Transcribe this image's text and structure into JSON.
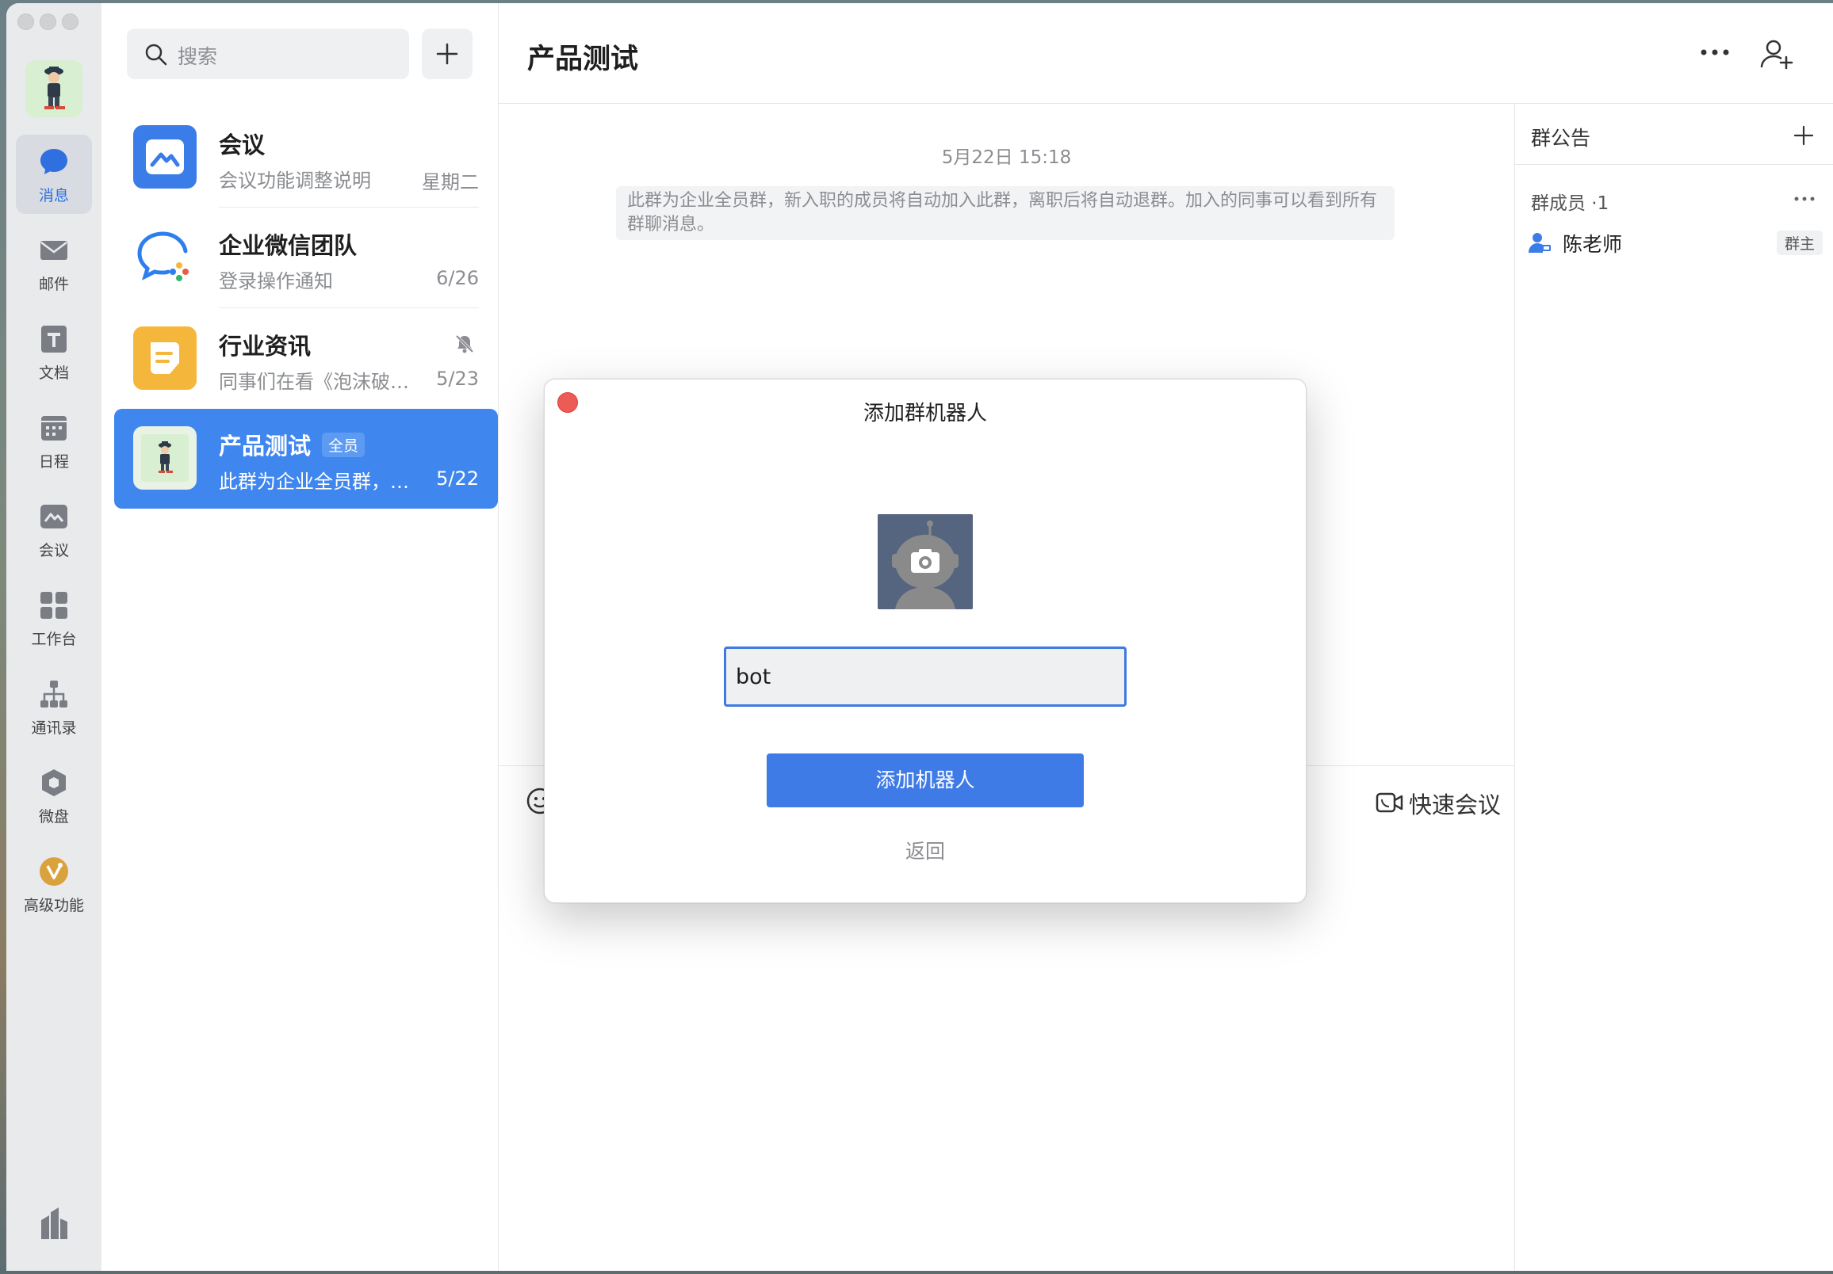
{
  "rail": {
    "items": [
      {
        "id": "messages",
        "label": "消息",
        "active": true
      },
      {
        "id": "mail",
        "label": "邮件"
      },
      {
        "id": "docs",
        "label": "文档"
      },
      {
        "id": "calendar",
        "label": "日程"
      },
      {
        "id": "meeting",
        "label": "会议"
      },
      {
        "id": "workbench",
        "label": "工作台"
      },
      {
        "id": "contacts",
        "label": "通讯录"
      },
      {
        "id": "drive",
        "label": "微盘"
      },
      {
        "id": "advanced",
        "label": "高级功能"
      }
    ]
  },
  "search": {
    "placeholder": "搜索"
  },
  "conversations": [
    {
      "name": "会议",
      "preview": "会议功能调整说明",
      "time": "星期二",
      "icon": "meeting-app-icon",
      "color": "#3b7de8"
    },
    {
      "name": "企业微信团队",
      "preview": "登录操作通知",
      "time": "6/26",
      "icon": "wecom-team-icon",
      "color": "#2d7ff0"
    },
    {
      "name": "行业资讯",
      "preview": "同事们在看《泡沫破…",
      "time": "5/23",
      "icon": "news-icon",
      "color": "#f5b73b",
      "muted": true
    },
    {
      "name": "产品测试",
      "badge": "全员",
      "preview": "此群为企业全员群，…",
      "time": "5/22",
      "active": true
    }
  ],
  "chat": {
    "title": "产品测试",
    "date": "5月22日 15:18",
    "system_message": "此群为企业全员群，新入职的成员将自动加入此群，离职后将自动退群。加入的同事可以看到所有群聊消息。",
    "quick_meeting": "快速会议"
  },
  "side": {
    "notice_title": "群公告",
    "members_title": "群成员 ·1",
    "members": [
      {
        "name": "陈老师",
        "role": "群主"
      }
    ]
  },
  "dialog": {
    "title": "添加群机器人",
    "name_value": "bot",
    "submit_label": "添加机器人",
    "back_label": "返回"
  },
  "colors": {
    "accent": "#3f7be6",
    "active_conv": "#3f86ee",
    "close": "#ec5b55"
  }
}
